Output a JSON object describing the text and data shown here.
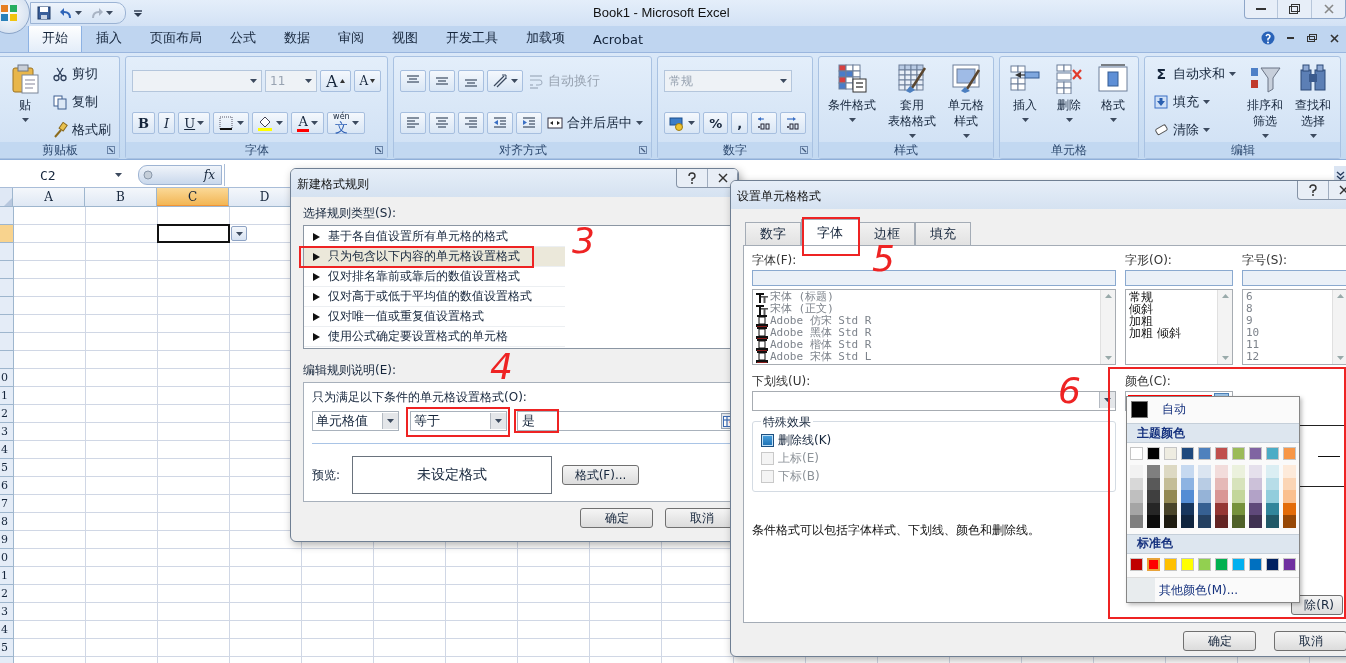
{
  "window": {
    "title": "Book1 - Microsoft Excel"
  },
  "ribbon": {
    "tabs": [
      {
        "label": "开始",
        "selected": true
      },
      {
        "label": "插入",
        "selected": false
      },
      {
        "label": "页面布局",
        "selected": false
      },
      {
        "label": "公式",
        "selected": false
      },
      {
        "label": "数据",
        "selected": false
      },
      {
        "label": "审阅",
        "selected": false
      },
      {
        "label": "视图",
        "selected": false
      },
      {
        "label": "开发工具",
        "selected": false
      },
      {
        "label": "加载项",
        "selected": false
      },
      {
        "label": "Acrobat",
        "selected": false
      }
    ],
    "groups": [
      {
        "label": "剪贴板",
        "launcher": true,
        "columns": [
          {
            "kind": "large",
            "lines": [
              "贴"
            ],
            "caret": true,
            "disabled": false
          },
          {
            "kind": "stack",
            "rows": [
              [
                {
                  "kind": "small",
                  "label": "剪切",
                  "caret": false,
                  "disabled": false
                }
              ],
              [
                {
                  "kind": "small",
                  "label": "复制",
                  "caret": false,
                  "disabled": false
                }
              ],
              [
                {
                  "kind": "small",
                  "label": "格式刷",
                  "caret": false,
                  "disabled": false
                }
              ]
            ]
          }
        ]
      },
      {
        "label": "字体",
        "launcher": true,
        "columns": [
          {
            "kind": "stack",
            "rows": [
              [
                {
                  "kind": "fontcombo",
                  "caret": true,
                  "disabled": true
                },
                {
                  "kind": "sizecombo",
                  "value": "11",
                  "caret": true,
                  "disabled": true
                },
                {
                  "kind": "grow",
                  "label": "A",
                  "caret": false,
                  "disabled": false
                },
                {
                  "kind": "shrink",
                  "label": "A",
                  "caret": false,
                  "disabled": false
                }
              ],
              [
                {
                  "kind": "bold",
                  "label": "B",
                  "caret": false,
                  "disabled": false
                },
                {
                  "kind": "italic",
                  "label": "I",
                  "caret": false,
                  "disabled": false
                },
                {
                  "kind": "underline",
                  "label": "U",
                  "caret": true,
                  "disabled": false
                },
                {
                  "kind": "icon",
                  "caret": true,
                  "disabled": false
                },
                {
                  "kind": "icon",
                  "caret": true,
                  "disabled": false
                },
                {
                  "kind": "fontcolor",
                  "label": "A",
                  "caret": true,
                  "disabled": false
                },
                {
                  "kind": "ruby",
                  "ruby": "wén",
                  "label": "文",
                  "caret": true,
                  "disabled": false
                }
              ]
            ]
          }
        ]
      },
      {
        "label": "对齐方式",
        "launcher": true,
        "columns": [
          {
            "kind": "stack",
            "rows": [
              [
                {
                  "kind": "icon",
                  "caret": false,
                  "disabled": false
                },
                {
                  "kind": "icon",
                  "caret": false,
                  "disabled": false
                },
                {
                  "kind": "icon",
                  "caret": false,
                  "disabled": false
                },
                {
                  "kind": "icon",
                  "caret": true,
                  "disabled": false
                },
                {
                  "kind": "small",
                  "label": "自动换行",
                  "caret": false,
                  "disabled": true
                }
              ],
              [
                {
                  "kind": "icon",
                  "caret": false,
                  "disabled": false
                },
                {
                  "kind": "icon",
                  "caret": false,
                  "disabled": false
                },
                {
                  "kind": "icon",
                  "caret": false,
                  "disabled": false
                },
                {
                  "kind": "icon",
                  "caret": false,
                  "disabled": false
                },
                {
                  "kind": "icon",
                  "caret": false,
                  "disabled": false
                },
                {
                  "kind": "small",
                  "label": "合并后居中",
                  "caret": true,
                  "disabled": false
                }
              ]
            ]
          }
        ]
      },
      {
        "label": "数字",
        "launcher": true,
        "columns": [
          {
            "kind": "stack",
            "rows": [
              [
                {
                  "kind": "formatcombo",
                  "value": "常规",
                  "caret": true,
                  "disabled": true
                }
              ],
              [
                {
                  "kind": "icon",
                  "caret": true,
                  "disabled": false
                },
                {
                  "kind": "text",
                  "label": "%",
                  "caret": false,
                  "disabled": false
                },
                {
                  "kind": "text",
                  "label": ",",
                  "caret": false,
                  "disabled": false
                },
                {
                  "kind": "icon",
                  "caret": false,
                  "disabled": false
                },
                {
                  "kind": "icon",
                  "caret": false,
                  "disabled": false
                }
              ]
            ]
          }
        ]
      },
      {
        "label": "样式",
        "launcher": false,
        "columns": [
          {
            "kind": "large",
            "lines": [
              "条件格式"
            ],
            "caret": true,
            "disabled": false
          },
          {
            "kind": "large",
            "lines": [
              "套用",
              "表格格式"
            ],
            "caret": true,
            "disabled": false
          },
          {
            "kind": "large",
            "lines": [
              "单元格",
              "样式"
            ],
            "caret": true,
            "disabled": false
          }
        ]
      },
      {
        "label": "单元格",
        "launcher": false,
        "columns": [
          {
            "kind": "large",
            "lines": [
              "插入"
            ],
            "caret": true,
            "disabled": false
          },
          {
            "kind": "large",
            "lines": [
              "删除"
            ],
            "caret": true,
            "disabled": false
          },
          {
            "kind": "large",
            "lines": [
              "格式"
            ],
            "caret": true,
            "disabled": false
          }
        ]
      },
      {
        "label": "编辑",
        "launcher": false,
        "columns": [
          {
            "kind": "stack",
            "rows": [
              [
                {
                  "kind": "small",
                  "glyph": "Σ",
                  "label": "自动求和",
                  "caret": true,
                  "disabled": false
                }
              ],
              [
                {
                  "kind": "small",
                  "label": "填充",
                  "caret": true,
                  "disabled": false
                }
              ],
              [
                {
                  "kind": "small",
                  "label": "清除",
                  "caret": true,
                  "disabled": false
                }
              ]
            ]
          },
          {
            "kind": "large",
            "lines": [
              "排序和",
              "筛选"
            ],
            "caret": true,
            "disabled": false
          },
          {
            "kind": "large",
            "lines": [
              "查找和",
              "选择"
            ],
            "caret": true,
            "disabled": false
          }
        ]
      }
    ]
  },
  "formula_bar": {
    "name_box": "C2",
    "fx": "fx"
  },
  "sheet": {
    "columns": [
      {
        "label": "A",
        "selected": false
      },
      {
        "label": "B",
        "selected": false
      },
      {
        "label": "C",
        "selected": true
      },
      {
        "label": "D",
        "selected": false
      }
    ],
    "rows": [
      {
        "selected": false
      },
      {
        "selected": true
      },
      {
        "selected": false
      },
      {
        "selected": false
      },
      {
        "selected": false
      },
      {
        "selected": false
      },
      {
        "selected": false
      },
      {
        "selected": false
      },
      {
        "selected": false
      },
      {
        "header": "0",
        "selected": false
      },
      {
        "header": "1",
        "selected": false
      },
      {
        "header": "2",
        "selected": false
      },
      {
        "header": "3",
        "selected": false
      },
      {
        "header": "4",
        "selected": false
      },
      {
        "header": "5",
        "selected": false
      },
      {
        "header": "6",
        "selected": false
      },
      {
        "header": "7",
        "selected": false
      },
      {
        "header": "8",
        "selected": false
      },
      {
        "header": "9",
        "selected": false
      },
      {
        "header": "0",
        "selected": false
      },
      {
        "header": "1",
        "selected": false
      },
      {
        "header": "2",
        "selected": false
      },
      {
        "header": "3",
        "selected": false
      },
      {
        "header": "4",
        "selected": false
      },
      {
        "header": "5",
        "selected": false
      }
    ]
  },
  "rule_dialog": {
    "title": "新建格式规则",
    "type_label": "选择规则类型(S):",
    "rule_types": [
      {
        "label": "基于各自值设置所有单元格的格式",
        "selected": false
      },
      {
        "label": "只为包含以下内容的单元格设置格式",
        "selected": true
      },
      {
        "label": "仅对排名靠前或靠后的数值设置格式",
        "selected": false
      },
      {
        "label": "仅对高于或低于平均值的数值设置格式",
        "selected": false
      },
      {
        "label": "仅对唯一值或重复值设置格式",
        "selected": false
      },
      {
        "label": "使用公式确定要设置格式的单元格",
        "selected": false
      }
    ],
    "edit_label": "编辑规则说明(E):",
    "condition_label": "只为满足以下条件的单元格设置格式(O):",
    "condition": {
      "field": "单元格值",
      "operator": "等于",
      "value": "是"
    },
    "preview_label": "预览:",
    "preview_text": "未设定格式",
    "format_button": "格式(F)...",
    "buttons": [
      "确定",
      "取消"
    ]
  },
  "format_dialog": {
    "title": "设置单元格格式",
    "tabs": [
      {
        "label": "数字",
        "selected": false
      },
      {
        "label": "字体",
        "selected": true
      },
      {
        "label": "边框",
        "selected": false
      },
      {
        "label": "填充",
        "selected": false
      }
    ],
    "font_label": "字体(F):",
    "fonts": {
      "disabled": true,
      "items": [
        {
          "label": "宋体 (标题)",
          "kind": "theme"
        },
        {
          "label": "宋体 (正文)",
          "kind": "theme"
        },
        {
          "label": "Adobe 仿宋 Std R",
          "kind": "opentype"
        },
        {
          "label": "Adobe 黑体 Std R",
          "kind": "opentype"
        },
        {
          "label": "Adobe 楷体 Std R",
          "kind": "opentype"
        },
        {
          "label": "Adobe 宋体 Std L",
          "kind": "opentype"
        }
      ]
    },
    "style_label": "字形(O):",
    "styles": {
      "disabled": false,
      "items": [
        "常规",
        "倾斜",
        "加粗",
        "加粗 倾斜"
      ]
    },
    "size_label": "字号(S):",
    "sizes": {
      "disabled": true,
      "items": [
        "6",
        "8",
        "9",
        "10",
        "11",
        "12"
      ]
    },
    "underline_label": "下划线(U):",
    "color_label": "颜色(C):",
    "color": "#ff0000",
    "effects_label": "特殊效果",
    "effects": [
      {
        "label": "删除线(K)",
        "checked": true,
        "disabled": false
      },
      {
        "label": "上标(E)",
        "checked": false,
        "disabled": true
      },
      {
        "label": "下标(B)",
        "checked": false,
        "disabled": true
      }
    ],
    "note": "条件格式可以包括字体样式、下划线、颜色和删除线。",
    "clear_button": "除(R)",
    "buttons": [
      "确定",
      "取消"
    ]
  },
  "color_menu": {
    "auto": {
      "label": "自动",
      "color": "#000000"
    },
    "theme_label": "主题颜色",
    "theme": [
      {
        "color": "#ffffff",
        "selected": false,
        "shades": [
          {
            "color": "#f2f2f2"
          },
          {
            "color": "#d8d8d8"
          },
          {
            "color": "#bfbfbf"
          },
          {
            "color": "#a5a5a5"
          },
          {
            "color": "#7f7f7f"
          }
        ]
      },
      {
        "color": "#000000",
        "selected": false,
        "shades": [
          {
            "color": "#7f7f7f"
          },
          {
            "color": "#595959"
          },
          {
            "color": "#3f3f3f"
          },
          {
            "color": "#262626"
          },
          {
            "color": "#0c0c0c"
          }
        ]
      },
      {
        "color": "#eeece1",
        "selected": false,
        "shades": [
          {
            "color": "#ddd9c3"
          },
          {
            "color": "#c4bd97"
          },
          {
            "color": "#938953"
          },
          {
            "color": "#494429"
          },
          {
            "color": "#1d1b10"
          }
        ]
      },
      {
        "color": "#1f497d",
        "selected": false,
        "shades": [
          {
            "color": "#c6d9f0"
          },
          {
            "color": "#8db3e2"
          },
          {
            "color": "#548dd4"
          },
          {
            "color": "#17365d"
          },
          {
            "color": "#0f243e"
          }
        ]
      },
      {
        "color": "#4f81bd",
        "selected": false,
        "shades": [
          {
            "color": "#dbe5f1"
          },
          {
            "color": "#b8cce4"
          },
          {
            "color": "#95b3d7"
          },
          {
            "color": "#366092"
          },
          {
            "color": "#244061"
          }
        ]
      },
      {
        "color": "#c0504d",
        "selected": false,
        "shades": [
          {
            "color": "#f2dcdb"
          },
          {
            "color": "#e5b9b7"
          },
          {
            "color": "#d99694"
          },
          {
            "color": "#953734"
          },
          {
            "color": "#632423"
          }
        ]
      },
      {
        "color": "#9bbb59",
        "selected": false,
        "shades": [
          {
            "color": "#ebf1dd"
          },
          {
            "color": "#d7e3bc"
          },
          {
            "color": "#c3d69b"
          },
          {
            "color": "#76923c"
          },
          {
            "color": "#4f6128"
          }
        ]
      },
      {
        "color": "#8064a2",
        "selected": false,
        "shades": [
          {
            "color": "#e5e0ec"
          },
          {
            "color": "#ccc1d9"
          },
          {
            "color": "#b2a2c7"
          },
          {
            "color": "#5f497a"
          },
          {
            "color": "#3f3151"
          }
        ]
      },
      {
        "color": "#4bacc6",
        "selected": false,
        "shades": [
          {
            "color": "#dbeef3"
          },
          {
            "color": "#b7dde8"
          },
          {
            "color": "#92cddc"
          },
          {
            "color": "#31859b"
          },
          {
            "color": "#205867"
          }
        ]
      },
      {
        "color": "#f79646",
        "selected": false,
        "shades": [
          {
            "color": "#fdeada"
          },
          {
            "color": "#fbd5b5"
          },
          {
            "color": "#fac08f"
          },
          {
            "color": "#e36c09"
          },
          {
            "color": "#974806"
          }
        ]
      }
    ],
    "standard_label": "标准色",
    "standard": [
      {
        "color": "#c00000",
        "selected": false
      },
      {
        "color": "#ff0000",
        "selected": true
      },
      {
        "color": "#ffc000",
        "selected": false
      },
      {
        "color": "#ffff00",
        "selected": false
      },
      {
        "color": "#92d050",
        "selected": false
      },
      {
        "color": "#00b050",
        "selected": false
      },
      {
        "color": "#00b0f0",
        "selected": false
      },
      {
        "color": "#0070c0",
        "selected": false
      },
      {
        "color": "#002060",
        "selected": false
      },
      {
        "color": "#7030a0",
        "selected": false
      }
    ],
    "more_label": "其他颜色(M)..."
  },
  "annotations": [
    "3",
    "4",
    "5",
    "6"
  ]
}
